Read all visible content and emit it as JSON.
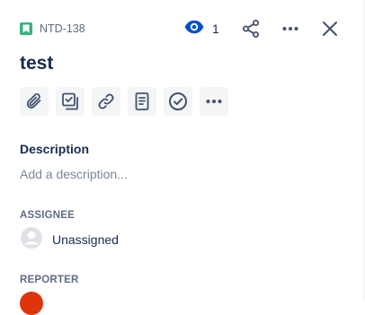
{
  "issue": {
    "key": "NTD-138",
    "type_icon": "story-icon",
    "title": "test"
  },
  "header": {
    "watch_count": "1",
    "watch_icon": "eye-icon",
    "share_icon": "share-icon",
    "more_icon": "more-horizontal-icon",
    "close_icon": "close-icon"
  },
  "actions": [
    {
      "name": "attach",
      "icon": "paperclip-icon"
    },
    {
      "name": "child-issue",
      "icon": "subtask-icon"
    },
    {
      "name": "link-issue",
      "icon": "link-icon"
    },
    {
      "name": "page",
      "icon": "document-icon"
    },
    {
      "name": "checklist",
      "icon": "check-circle-icon"
    },
    {
      "name": "more",
      "icon": "more-horizontal-icon"
    }
  ],
  "description": {
    "heading": "Description",
    "placeholder": "Add a description..."
  },
  "assignee": {
    "label": "ASSIGNEE",
    "value": "Unassigned"
  },
  "reporter": {
    "label": "REPORTER"
  },
  "colors": {
    "accent": "#0052cc",
    "story": "#36b37e",
    "text": "#172b4d",
    "subtle": "#5e6c84",
    "button_bg": "#f4f5f7",
    "reporter_avatar": "#de350b"
  }
}
